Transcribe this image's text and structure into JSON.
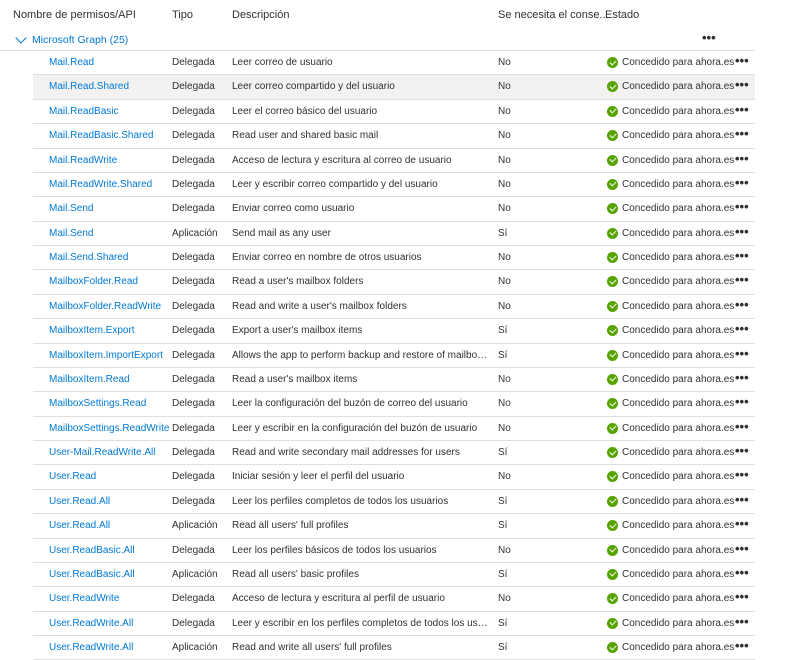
{
  "columns": {
    "name": "Nombre de permisos/API",
    "type": "Tipo",
    "desc": "Descripción",
    "consent": "Se necesita el conse...",
    "status": "Estado"
  },
  "group": {
    "label": "Microsoft Graph (25)",
    "more": "•••"
  },
  "rows": [
    {
      "name": "Mail.Read",
      "type": "Delegada",
      "desc": "Leer correo de usuario",
      "consent": "No",
      "status": "Concedido para ahora.es",
      "more": "•••"
    },
    {
      "name": "Mail.Read.Shared",
      "type": "Delegada",
      "desc": "Leer correo compartido y del usuario",
      "consent": "No",
      "status": "Concedido para ahora.es",
      "more": "•••"
    },
    {
      "name": "Mail.ReadBasic",
      "type": "Delegada",
      "desc": "Leer el correo básico del usuario",
      "consent": "No",
      "status": "Concedido para ahora.es",
      "more": "•••"
    },
    {
      "name": "Mail.ReadBasic.Shared",
      "type": "Delegada",
      "desc": "Read user and shared basic mail",
      "consent": "No",
      "status": "Concedido para ahora.es",
      "more": "•••"
    },
    {
      "name": "Mail.ReadWrite",
      "type": "Delegada",
      "desc": "Acceso de lectura y escritura al correo de usuario",
      "consent": "No",
      "status": "Concedido para ahora.es",
      "more": "•••"
    },
    {
      "name": "Mail.ReadWrite.Shared",
      "type": "Delegada",
      "desc": "Leer y escribir correo compartido y del usuario",
      "consent": "No",
      "status": "Concedido para ahora.es",
      "more": "•••"
    },
    {
      "name": "Mail.Send",
      "type": "Delegada",
      "desc": "Enviar correo como usuario",
      "consent": "No",
      "status": "Concedido para ahora.es",
      "more": "•••"
    },
    {
      "name": "Mail.Send",
      "type": "Aplicación",
      "desc": "Send mail as any user",
      "consent": "Sí",
      "status": "Concedido para ahora.es",
      "more": "•••"
    },
    {
      "name": "Mail.Send.Shared",
      "type": "Delegada",
      "desc": "Enviar correo en nombre de otros usuarios",
      "consent": "No",
      "status": "Concedido para ahora.es",
      "more": "•••"
    },
    {
      "name": "MailboxFolder.Read",
      "type": "Delegada",
      "desc": "Read a user's mailbox folders",
      "consent": "No",
      "status": "Concedido para ahora.es",
      "more": "•••"
    },
    {
      "name": "MailboxFolder.ReadWrite",
      "type": "Delegada",
      "desc": "Read and write a user's mailbox folders",
      "consent": "No",
      "status": "Concedido para ahora.es",
      "more": "•••"
    },
    {
      "name": "MailboxItem.Export",
      "type": "Delegada",
      "desc": "Export a user's mailbox items",
      "consent": "Sí",
      "status": "Concedido para ahora.es",
      "more": "•••"
    },
    {
      "name": "MailboxItem.ImportExport",
      "type": "Delegada",
      "desc": "Allows the app to perform backup and restore of mailbox ...",
      "consent": "Sí",
      "status": "Concedido para ahora.es",
      "more": "•••"
    },
    {
      "name": "MailboxItem.Read",
      "type": "Delegada",
      "desc": "Read a user's mailbox items",
      "consent": "No",
      "status": "Concedido para ahora.es",
      "more": "•••"
    },
    {
      "name": "MailboxSettings.Read",
      "type": "Delegada",
      "desc": "Leer la configuración del buzón de correo del usuario",
      "consent": "No",
      "status": "Concedido para ahora.es",
      "more": "•••"
    },
    {
      "name": "MailboxSettings.ReadWrite",
      "type": "Delegada",
      "desc": "Leer y escribir en la configuración del buzón de usuario",
      "consent": "No",
      "status": "Concedido para ahora.es",
      "more": "•••"
    },
    {
      "name": "User-Mail.ReadWrite.All",
      "type": "Delegada",
      "desc": "Read and write secondary mail addresses for users",
      "consent": "Sí",
      "status": "Concedido para ahora.es",
      "more": "•••"
    },
    {
      "name": "User.Read",
      "type": "Delegada",
      "desc": "Iniciar sesión y leer el perfil del usuario",
      "consent": "No",
      "status": "Concedido para ahora.es",
      "more": "•••"
    },
    {
      "name": "User.Read.All",
      "type": "Delegada",
      "desc": "Leer los perfiles completos de todos los usuarios",
      "consent": "Sí",
      "status": "Concedido para ahora.es",
      "more": "•••"
    },
    {
      "name": "User.Read.All",
      "type": "Aplicación",
      "desc": "Read all users' full profiles",
      "consent": "Sí",
      "status": "Concedido para ahora.es",
      "more": "•••"
    },
    {
      "name": "User.ReadBasic.All",
      "type": "Delegada",
      "desc": "Leer los perfiles básicos de todos los usuarios",
      "consent": "No",
      "status": "Concedido para ahora.es",
      "more": "•••"
    },
    {
      "name": "User.ReadBasic.All",
      "type": "Aplicación",
      "desc": "Read all users' basic profiles",
      "consent": "Sí",
      "status": "Concedido para ahora.es",
      "more": "•••"
    },
    {
      "name": "User.ReadWrite",
      "type": "Delegada",
      "desc": "Acceso de lectura y escritura al perfil de usuario",
      "consent": "No",
      "status": "Concedido para ahora.es",
      "more": "•••"
    },
    {
      "name": "User.ReadWrite.All",
      "type": "Delegada",
      "desc": "Leer y escribir en los perfiles completos de todos los usuar...",
      "consent": "Sí",
      "status": "Concedido para ahora.es",
      "more": "•••"
    },
    {
      "name": "User.ReadWrite.All",
      "type": "Aplicación",
      "desc": "Read and write all users' full profiles",
      "consent": "Sí",
      "status": "Concedido para ahora.es",
      "more": "•••"
    }
  ],
  "highlighted_row": 1,
  "colors": {
    "link": "#0078d4",
    "granted": "#57a300",
    "hover": "#f3f2f1"
  },
  "icons": {
    "group_toggle": "chevron-down-icon",
    "status": "check-circle-icon",
    "row_menu": "more-icon"
  }
}
